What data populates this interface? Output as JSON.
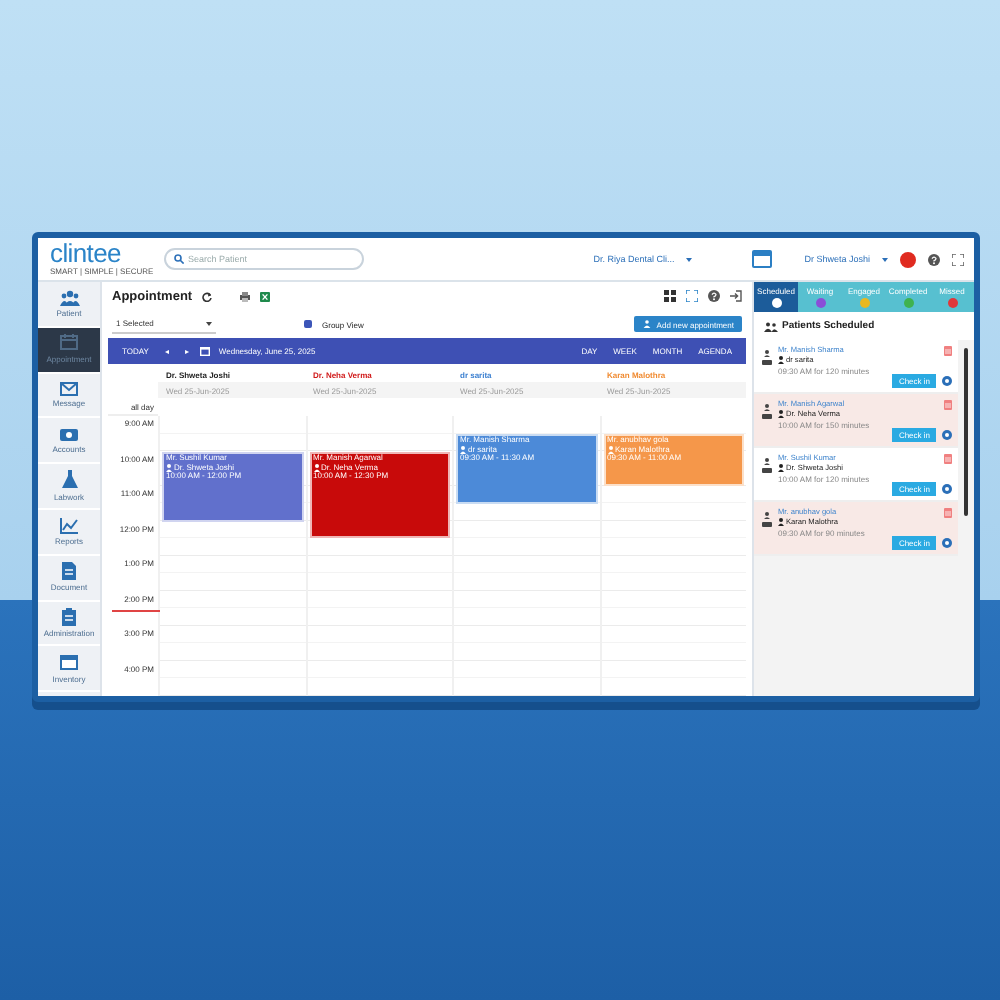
{
  "header": {
    "logo": "clintee",
    "tagline": "SMART | SIMPLE | SECURE",
    "search": {
      "placeholder": "Search Patient"
    },
    "clinic": "Dr. Riya Dental Cli...",
    "user": "Dr Shweta Joshi"
  },
  "sidebar": {
    "items": [
      {
        "label": "Patient",
        "selected": false
      },
      {
        "label": "Appointment",
        "selected": true
      },
      {
        "label": "Message",
        "selected": false
      },
      {
        "label": "Accounts",
        "selected": false
      },
      {
        "label": "Labwork",
        "selected": false
      },
      {
        "label": "Reports",
        "selected": false
      },
      {
        "label": "Document",
        "selected": false
      },
      {
        "label": "Administration",
        "selected": false
      },
      {
        "label": "Inventory",
        "selected": false
      }
    ]
  },
  "appointment": {
    "title": "Appointment",
    "selection": "1 Selected",
    "group_view": {
      "label": "Group View",
      "checked": true
    },
    "add_button": "Add new appointment"
  },
  "toolbar": {
    "today": "TODAY",
    "prev": "◂",
    "next": "▸",
    "date": "Wednesday, June 25, 2025",
    "views": [
      {
        "label": "DAY",
        "selected": false
      },
      {
        "label": "WEEK",
        "selected": false
      },
      {
        "label": "MONTH",
        "selected": false
      },
      {
        "label": "AGENDA",
        "selected": false
      }
    ]
  },
  "calendar": {
    "all_day": "all day",
    "hours": [
      "9:00 AM",
      "10:00 AM",
      "11:00 AM",
      "12:00 PM",
      "1:00 PM",
      "2:00 PM",
      "3:00 PM",
      "4:00 PM"
    ],
    "columns": [
      {
        "name": "Dr. Shweta Joshi",
        "color": "#222222",
        "date": "Wed 25-Jun-2025",
        "events": [
          {
            "patient": "Mr. Sushil Kumar",
            "doctor": "Dr. Shweta Joshi",
            "time": "10:00 AM - 12:00 PM",
            "color": "#6170cc"
          }
        ]
      },
      {
        "name": "Dr. Neha Verma",
        "color": "#d01818",
        "date": "Wed 25-Jun-2025",
        "events": [
          {
            "patient": "Mr. Manish Agarwal",
            "doctor": "Dr. Neha Verma",
            "time": "10:00 AM - 12:30 PM",
            "color": "#c80a0a"
          }
        ]
      },
      {
        "name": "dr sarita",
        "color": "#3a7fd0",
        "date": "Wed 25-Jun-2025",
        "events": [
          {
            "patient": "Mr. Manish Sharma",
            "doctor": "dr sarita",
            "time": "09:30 AM - 11:30 AM",
            "color": "#4c8ad8"
          }
        ]
      },
      {
        "name": "Karan Malothra",
        "color": "#f08a30",
        "date": "Wed 25-Jun-2025",
        "events": [
          {
            "patient": "Mr. anubhav gola",
            "doctor": "Karan Malothra",
            "time": "09:30 AM - 11:00 AM",
            "color": "#f5974a"
          }
        ]
      }
    ]
  },
  "panel": {
    "tabs": [
      {
        "label": "Scheduled",
        "selected": true,
        "color": "#ffffff"
      },
      {
        "label": "Waiting",
        "selected": false,
        "color": "#8a4fd8"
      },
      {
        "label": "Engaged",
        "selected": false,
        "color": "#e8b820"
      },
      {
        "label": "Completed",
        "selected": false,
        "color": "#3fb24f"
      },
      {
        "label": "Missed",
        "selected": false,
        "color": "#e0383b"
      }
    ],
    "heading": "Patients Scheduled",
    "patients": [
      {
        "name": "Mr. Manish Sharma",
        "doctor": "dr sarita",
        "time": "09:30 AM for 120 minutes",
        "highlighted": false,
        "button": "Check in"
      },
      {
        "name": "Mr. Manish Agarwal",
        "doctor": "Dr. Neha Verma",
        "time": "10:00 AM for 150 minutes",
        "highlighted": true,
        "button": "Check in"
      },
      {
        "name": "Mr. Sushil Kumar",
        "doctor": "Dr. Shweta Joshi",
        "time": "10:00 AM for 120 minutes",
        "highlighted": false,
        "button": "Check in"
      },
      {
        "name": "Mr. anubhav gola",
        "doctor": "Karan Malothra",
        "time": "09:30 AM for 90 minutes",
        "highlighted": true,
        "button": "Check in"
      }
    ]
  }
}
